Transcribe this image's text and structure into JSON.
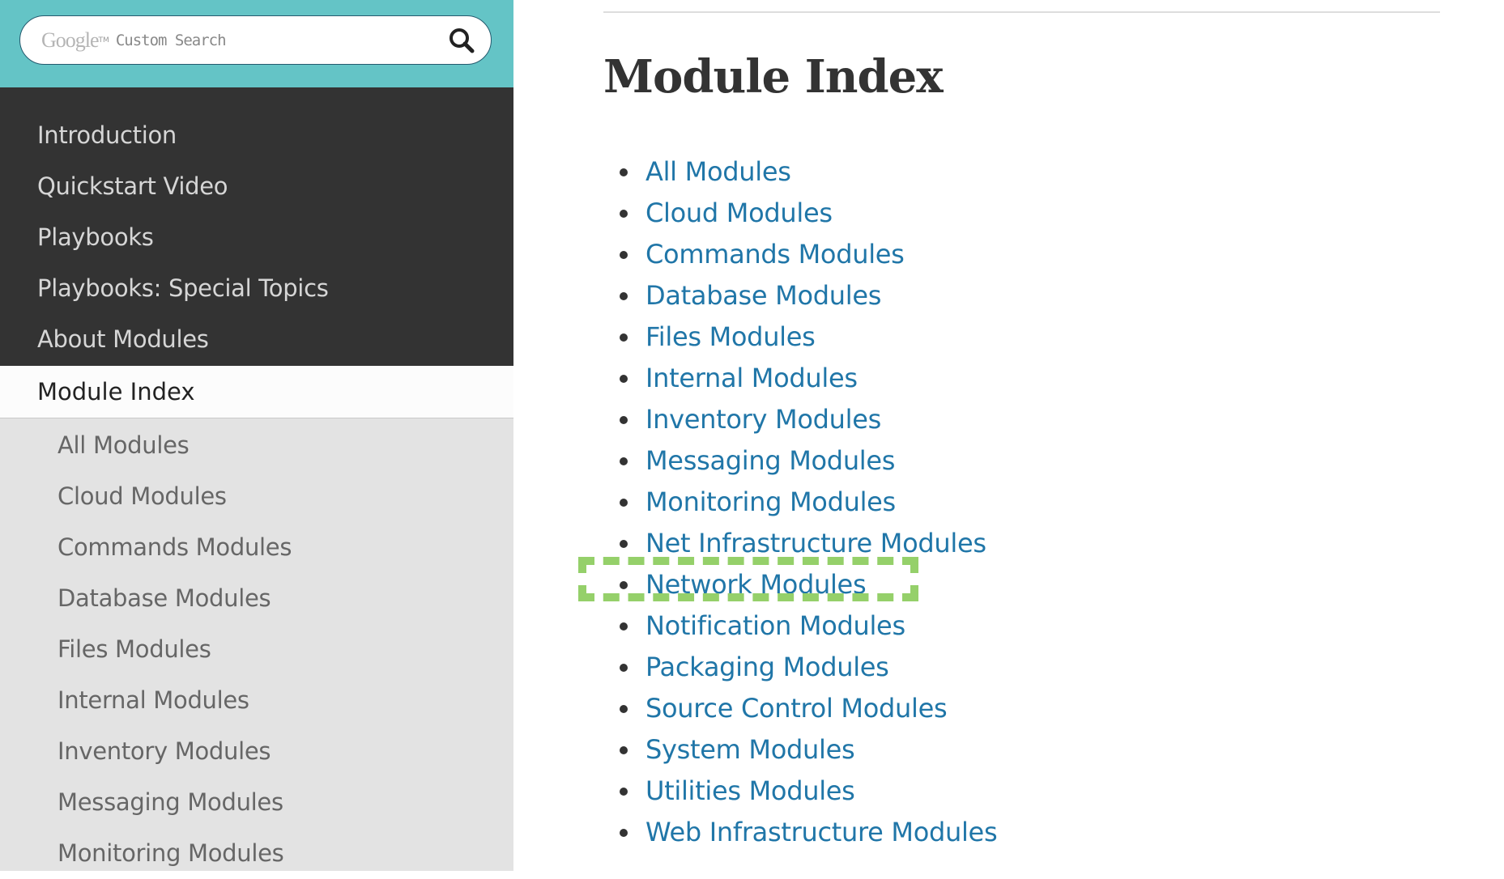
{
  "search": {
    "brand": "Google",
    "tm": "TM",
    "placeholder": "Custom Search",
    "icon": "search-icon"
  },
  "sidebar": {
    "items": [
      {
        "label": "Introduction"
      },
      {
        "label": "Quickstart Video"
      },
      {
        "label": "Playbooks"
      },
      {
        "label": "Playbooks: Special Topics"
      },
      {
        "label": "About Modules"
      }
    ],
    "active": "Module Index",
    "sub_items": [
      {
        "label": "All Modules"
      },
      {
        "label": "Cloud Modules"
      },
      {
        "label": "Commands Modules"
      },
      {
        "label": "Database Modules"
      },
      {
        "label": "Files Modules"
      },
      {
        "label": "Internal Modules"
      },
      {
        "label": "Inventory Modules"
      },
      {
        "label": "Messaging Modules"
      },
      {
        "label": "Monitoring Modules"
      }
    ]
  },
  "main": {
    "title": "Module Index",
    "links": [
      "All Modules",
      "Cloud Modules",
      "Commands Modules",
      "Database Modules",
      "Files Modules",
      "Internal Modules",
      "Inventory Modules",
      "Messaging Modules",
      "Monitoring Modules",
      "Net Infrastructure Modules",
      "Network Modules",
      "Notification Modules",
      "Packaging Modules",
      "Source Control Modules",
      "System Modules",
      "Utilities Modules",
      "Web Infrastructure Modules"
    ],
    "highlighted": "Network Modules"
  },
  "colors": {
    "teal": "#64c4c6",
    "dark": "#333333",
    "link": "#2076a8",
    "highlight": "#95d06a"
  }
}
